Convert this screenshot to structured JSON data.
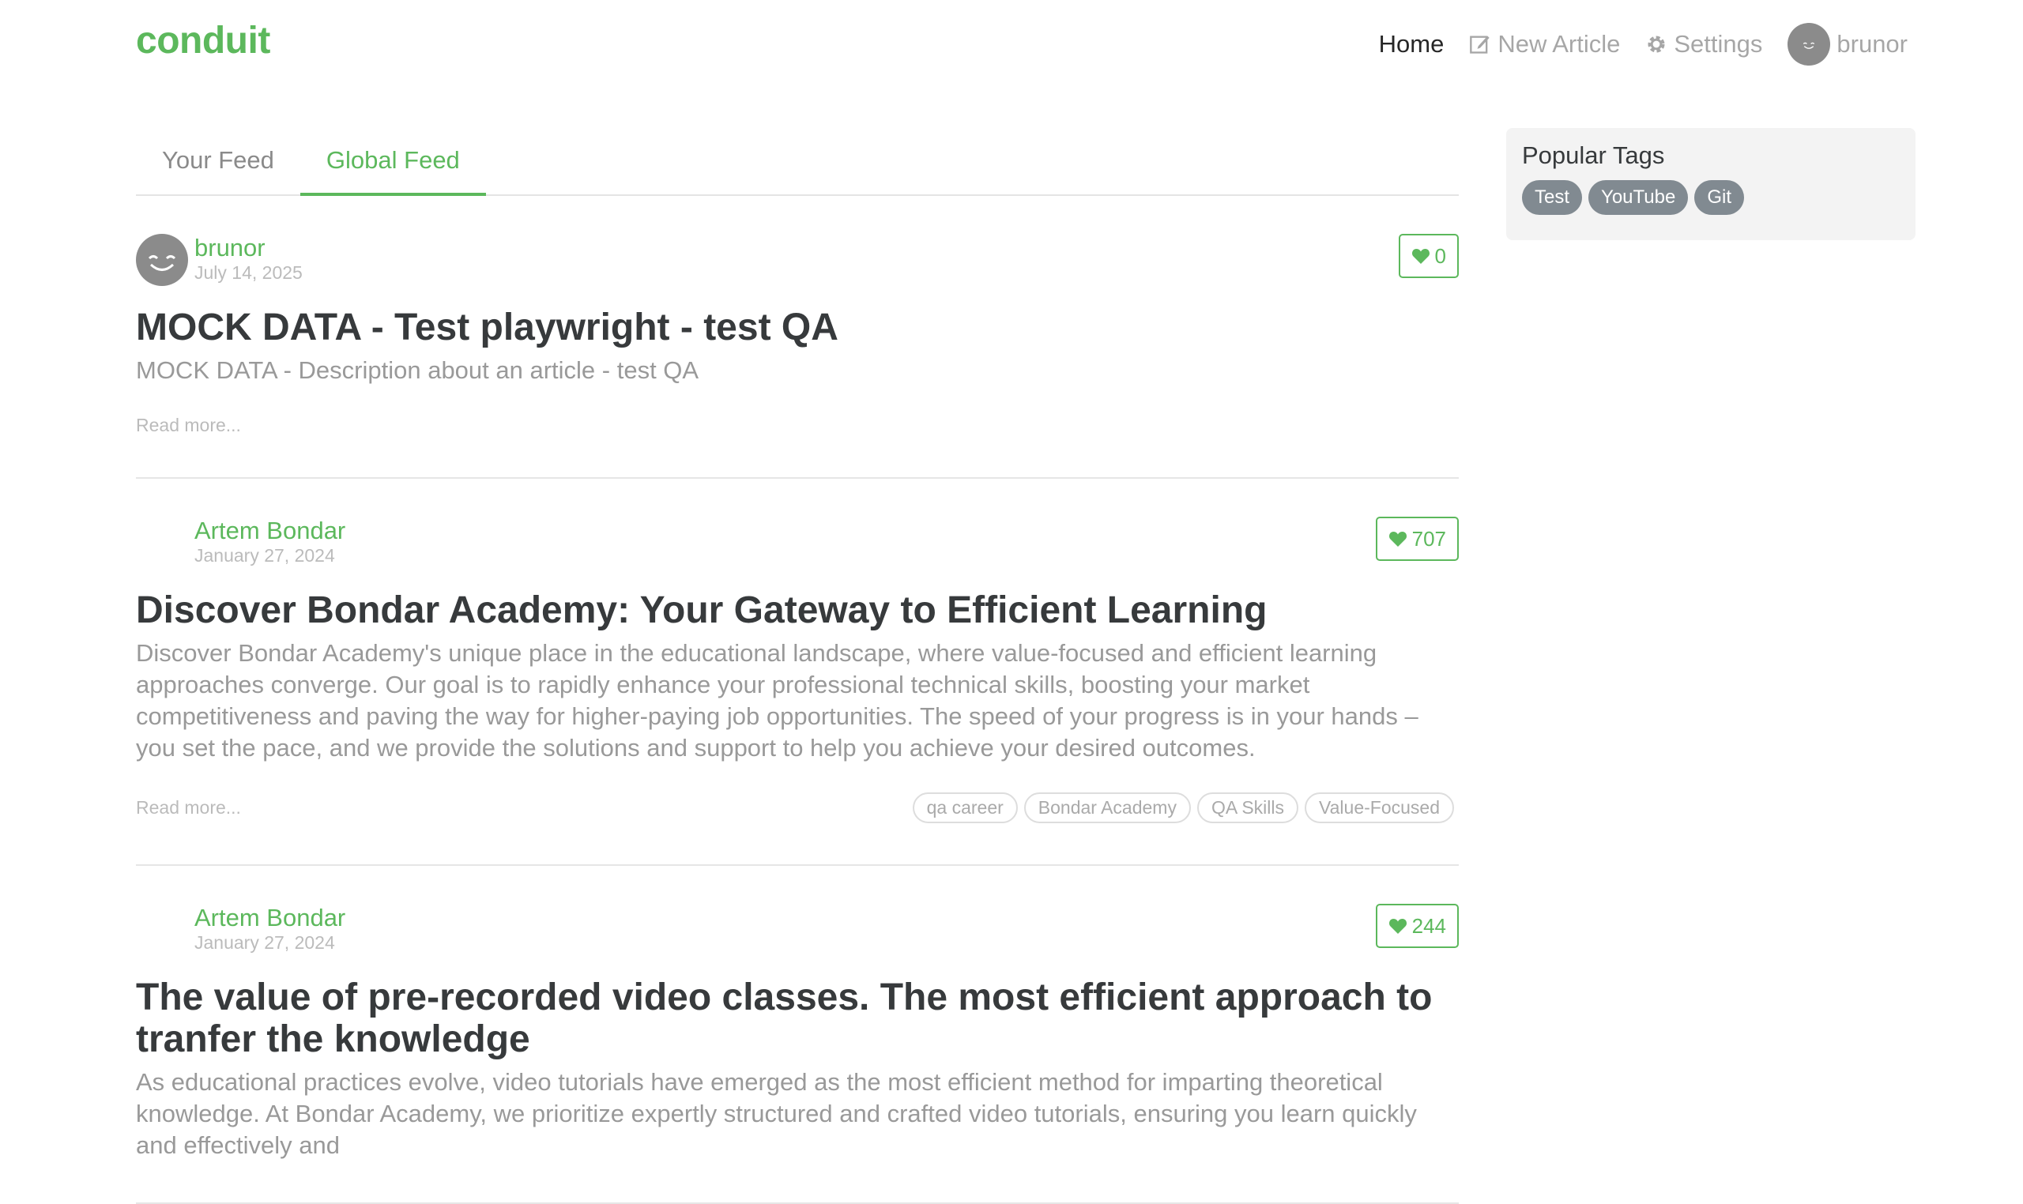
{
  "navbar": {
    "brand": "conduit",
    "links": {
      "home": "Home",
      "new_article": "New Article",
      "settings": "Settings",
      "user": "brunor"
    }
  },
  "feed": {
    "tabs": [
      "Your Feed",
      "Global Feed"
    ],
    "active_tab": "Global Feed",
    "articles": [
      {
        "author": "brunor",
        "date": "July 14, 2025",
        "favorites": "0",
        "title": "MOCK DATA - Test playwright - test QA",
        "description": "MOCK DATA - Description about an article - test QA",
        "read_more": "Read more...",
        "tags": []
      },
      {
        "author": "Artem Bondar",
        "date": "January 27, 2024",
        "favorites": "707",
        "title": "Discover Bondar Academy: Your Gateway to Efficient Learning",
        "description": "Discover Bondar Academy's unique place in the educational landscape, where value-focused and efficient learning approaches converge. Our goal is to rapidly enhance your professional technical skills, boosting your market competitiveness and paving the way for higher-paying job opportunities. The speed of your progress is in your hands – you set the pace, and we provide the solutions and support to help you achieve your desired outcomes.",
        "read_more": "Read more...",
        "tags": [
          "qa career",
          "Bondar Academy",
          "QA Skills",
          "Value-Focused"
        ]
      },
      {
        "author": "Artem Bondar",
        "date": "January 27, 2024",
        "favorites": "244",
        "title": "The value of pre-recorded video classes. The most efficient approach to tranfer the knowledge",
        "description": "As educational practices evolve, video tutorials have emerged as the most efficient method for imparting theoretical knowledge. At Bondar Academy, we prioritize expertly structured and crafted video tutorials, ensuring you learn quickly and effectively and"
      }
    ]
  },
  "sidebar": {
    "title": "Popular Tags",
    "tags": [
      "Test",
      "YouTube",
      "Git"
    ]
  },
  "colors": {
    "brand_green": "#5cb85c",
    "tag_pill_bg": "#818a91",
    "sidebar_bg": "#f3f3f3"
  }
}
